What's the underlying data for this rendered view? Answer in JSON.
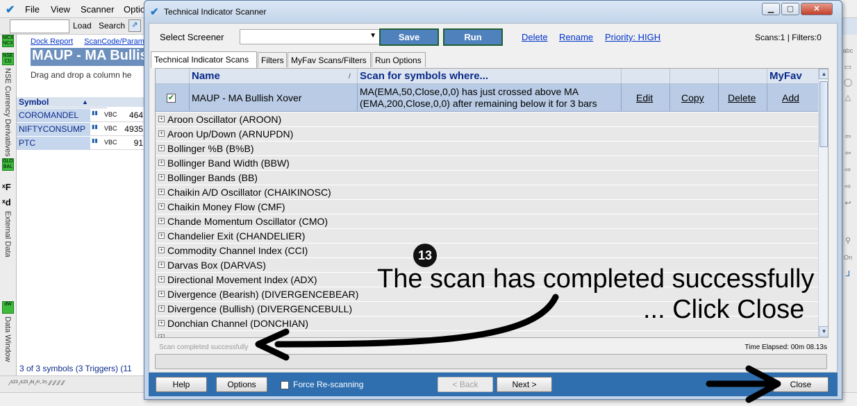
{
  "bg": {
    "menu": [
      "File",
      "View",
      "Scanner",
      "Optio"
    ],
    "toolbar": {
      "load": "Load",
      "search": "Search"
    },
    "strip": {
      "badge1": "MCX NCX",
      "badge2": "NSE CD",
      "vtext1": "NSE Currency Derivatives",
      "badge3": "GLO BAL",
      "vtext2": "External Data",
      "badge4": "dW",
      "vtext3": "Data Window"
    },
    "panel": {
      "link1": "Dock Report",
      "link2": "ScanCode/Param",
      "title": "MAUP - MA Bullis",
      "hint": "Drag and drop a column he",
      "symbol_header": "Symbol",
      "rows": [
        {
          "symbol": "COROMANDEL",
          "vbc": "VBC",
          "value": "464"
        },
        {
          "symbol": "NIFTYCONSUMP",
          "vbc": "VBC",
          "value": "4935"
        },
        {
          "symbol": "PTC",
          "vbc": "VBC",
          "value": "91"
        }
      ],
      "footer": "3 of 3 symbols (3 Triggers) (11"
    },
    "right_strip": [
      "abc",
      "On"
    ]
  },
  "dialog": {
    "title": "Technical Indicator Scanner",
    "select_screener_label": "Select Screener",
    "save": "Save",
    "run": "Run",
    "delete": "Delete",
    "rename": "Rename",
    "priority": "Priority: HIGH",
    "counts": "Scans:1 | Filters:0",
    "tabs": [
      "Technical Indicator Scans",
      "Filters",
      "MyFav Scans/Filters",
      "Run Options"
    ],
    "grid": {
      "col_name": "Name",
      "col_sort": "/",
      "col_scan": "Scan for symbols where...",
      "col_myfav": "MyFav",
      "selected": {
        "name": "MAUP - MA Bullish Xover",
        "condition": "MA(EMA,50,Close,0,0) has just crossed above MA (EMA,200,Close,0,0) after remaining below it for 3 bars",
        "edit": "Edit",
        "copy": "Copy",
        "delete": "Delete",
        "add": "Add"
      },
      "indicators": [
        "Aroon Oscillator (AROON)",
        "Aroon Up/Down (ARNUPDN)",
        "Bollinger %B (B%B)",
        "Bollinger Band Width (BBW)",
        "Bollinger Bands (BB)",
        "Chaikin A/D Oscillator (CHAIKINOSC)",
        "Chaikin Money Flow (CMF)",
        "Chande Momentum Oscillator (CMO)",
        "Chandelier Exit (CHANDELIER)",
        "Commodity Channel Index (CCI)",
        "Darvas Box (DARVAS)",
        "Directional Movement Index (ADX)",
        "Divergence (Bearish) (DIVERGENCEBEAR)",
        "Divergence (Bullish) (DIVERGENCEBULL)",
        "Donchian Channel (DONCHIAN)"
      ]
    },
    "status": "Scan completed successfully",
    "elapsed": "Time Elapsed: 00m 08.13s",
    "bottom": {
      "help": "Help",
      "options": "Options",
      "force": "Force Re-scanning",
      "back": "< Back",
      "next": "Next >",
      "close": "Close"
    }
  },
  "annotation": {
    "step": "13",
    "line1": "The scan has completed successfully",
    "line2": "... Click Close"
  }
}
